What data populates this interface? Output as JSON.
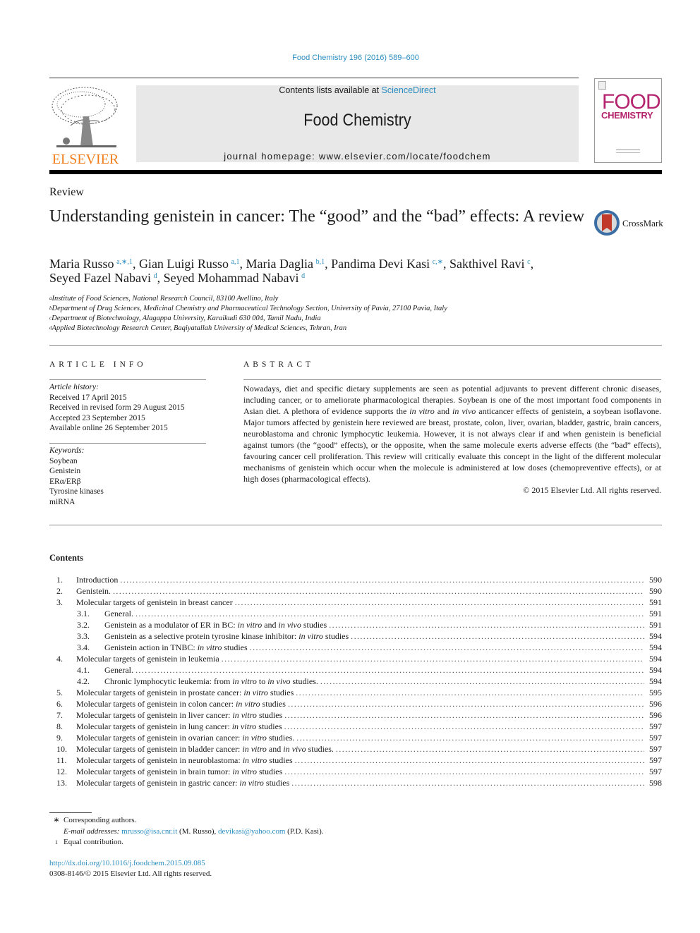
{
  "header": {
    "citation": "Food Chemistry 196 (2016) 589–600",
    "contents_prefix": "Contents lists available at ",
    "contents_link": "ScienceDirect",
    "journal_title": "Food Chemistry",
    "homepage_label": "journal homepage: www.elsevier.com/locate/foodchem",
    "publisher_logo_text": "ELSEVIER",
    "cover_line1": "FOOD",
    "cover_line2": "CHEMISTRY",
    "colors": {
      "link": "#2a8cbf",
      "elsevier_orange": "#f07d1a",
      "cover_magenta": "#b5246e",
      "banner_bg": "#e8e8e8"
    }
  },
  "article": {
    "type": "Review",
    "title": "Understanding genistein in cancer: The “good” and the “bad” effects: A review",
    "crossmark_label": "CrossMark",
    "authors": [
      {
        "name": "Maria Russo",
        "sup": "a,∗,1",
        "sep": ", "
      },
      {
        "name": "Gian Luigi Russo",
        "sup": "a,1",
        "sep": ", "
      },
      {
        "name": "Maria Daglia",
        "sup": "b,1",
        "sep": ", "
      },
      {
        "name": "Pandima Devi Kasi",
        "sup": "c,∗",
        "sep": ", "
      },
      {
        "name": "Sakthivel Ravi",
        "sup": "c",
        "sep": ","
      },
      {
        "name": "Seyed Fazel Nabavi",
        "sup": "d",
        "sep": ", "
      },
      {
        "name": "Seyed Mohammad Nabavi",
        "sup": "d",
        "sep": ""
      }
    ],
    "affiliations": [
      {
        "key": "a",
        "text": "Institute of Food Sciences, National Research Council, 83100 Avellino, Italy"
      },
      {
        "key": "b",
        "text": "Department of Drug Sciences, Medicinal Chemistry and Pharmaceutical Technology Section, University of Pavia, 27100 Pavia, Italy"
      },
      {
        "key": "c",
        "text": "Department of Biotechnology, Alagappa University, Karaikudi 630 004, Tamil Nadu, India"
      },
      {
        "key": "d",
        "text": "Applied Biotechnology Research Center, Baqiyatallah University of Medical Sciences, Tehran, Iran"
      }
    ]
  },
  "article_info": {
    "heading": "ARTICLE INFO",
    "history_label": "Article history:",
    "history": [
      "Received 17 April 2015",
      "Received in revised form 29 August 2015",
      "Accepted 23 September 2015",
      "Available online 26 September 2015"
    ],
    "keywords_label": "Keywords:",
    "keywords": [
      "Soybean",
      "Genistein",
      "ERα/ERβ",
      "Tyrosine kinases",
      "miRNA"
    ]
  },
  "abstract": {
    "heading": "ABSTRACT",
    "p1": "Nowadays, diet and specific dietary supplements are seen as potential adjuvants to prevent different chronic diseases, including cancer, or to ameliorate pharmacological therapies. Soybean is one of the most important food components in Asian diet. A plethora of evidence supports the ",
    "i1": "in vitro",
    "p2": " and ",
    "i2": "in vivo",
    "p3": " anticancer effects of genistein, a soybean isoflavone. Major tumors affected by genistein here reviewed are breast, prostate, colon, liver, ovarian, bladder, gastric, brain cancers, neuroblastoma and chronic lym­phocytic leukemia. However, it is not always clear if and when genistein is beneficial against tumors (the “good” effects), or the opposite, when the same molecule exerts adverse effects (the “bad” effects), favouring cancer cell proliferation. This review will critically evaluate this concept in the light of the different molecular mechanisms of genistein which occur when the molecule is administered at low doses (chemopreventive effects), or at high doses (pharmacological effects).",
    "copyright": "© 2015 Elsevier Ltd. All rights reserved."
  },
  "contents": {
    "heading": "Contents",
    "items": [
      {
        "num": "1.",
        "title": "Introduction",
        "page": "590",
        "sub": false
      },
      {
        "num": "2.",
        "title": "Genistein.",
        "page": "590",
        "sub": false
      },
      {
        "num": "3.",
        "title": "Molecular targets of genistein in breast cancer",
        "page": "591",
        "sub": false
      },
      {
        "num": "3.1.",
        "title": "General.",
        "page": "591",
        "sub": true
      },
      {
        "num": "3.2.",
        "title": "Genistein as a modulator of ER in BC: <i>in vitro</i> and <i>in vivo</i> studies",
        "page": "591",
        "sub": true
      },
      {
        "num": "3.3.",
        "title": "Genistein as a selective protein tyrosine kinase inhibitor: <i>in vitro</i> studies",
        "page": "594",
        "sub": true
      },
      {
        "num": "3.4.",
        "title": "Genistein action in TNBC: <i>in vitro</i> studies",
        "page": "594",
        "sub": true
      },
      {
        "num": "4.",
        "title": "Molecular targets of genistein in leukemia",
        "page": "594",
        "sub": false
      },
      {
        "num": "4.1.",
        "title": "General.",
        "page": "594",
        "sub": true
      },
      {
        "num": "4.2.",
        "title": "Chronic lymphocytic leukemia: from <i>in vitro</i> to <i>in vivo</i> studies.",
        "page": "594",
        "sub": true
      },
      {
        "num": "5.",
        "title": "Molecular targets of genistein in prostate cancer: <i>in vitro</i> studies",
        "page": "595",
        "sub": false
      },
      {
        "num": "6.",
        "title": "Molecular targets of genistein in colon cancer: <i>in vitro</i> studies",
        "page": "596",
        "sub": false
      },
      {
        "num": "7.",
        "title": "Molecular targets of genistein in liver cancer: <i>in vitro</i> studies",
        "page": "596",
        "sub": false
      },
      {
        "num": "8.",
        "title": "Molecular targets of genistein in lung cancer: <i>in vitro</i> studies",
        "page": "597",
        "sub": false
      },
      {
        "num": "9.",
        "title": "Molecular targets of genistein in ovarian cancer: <i>in vitro</i> studies.",
        "page": "597",
        "sub": false
      },
      {
        "num": "10.",
        "title": "Molecular targets of genistein in bladder cancer: <i>in vitro</i> and <i>in vivo</i> studies.",
        "page": "597",
        "sub": false
      },
      {
        "num": "11.",
        "title": "Molecular targets of genistein in neuroblastoma: <i>in vitro</i> studies",
        "page": "597",
        "sub": false
      },
      {
        "num": "12.",
        "title": "Molecular targets of genistein in brain tumor: <i>in vitro</i> studies",
        "page": "597",
        "sub": false
      },
      {
        "num": "13.",
        "title": "Molecular targets of genistein in gastric cancer: <i>in vitro</i> studies",
        "page": "598",
        "sub": false
      }
    ]
  },
  "footnotes": {
    "star_mark": "∗",
    "corresponding": "Corresponding authors.",
    "email_label": "E-mail addresses:",
    "email1": "mrusso@isa.cnr.it",
    "email1_name": " (M. Russo), ",
    "email2": "devikasi@yahoo.com",
    "email2_name": " (P.D. Kasi).",
    "one_mark": "1",
    "equal": "Equal contribution.",
    "doi": "http://dx.doi.org/10.1016/j.foodchem.2015.09.085",
    "issn": "0308-8146/© 2015 Elsevier Ltd. All rights reserved."
  }
}
